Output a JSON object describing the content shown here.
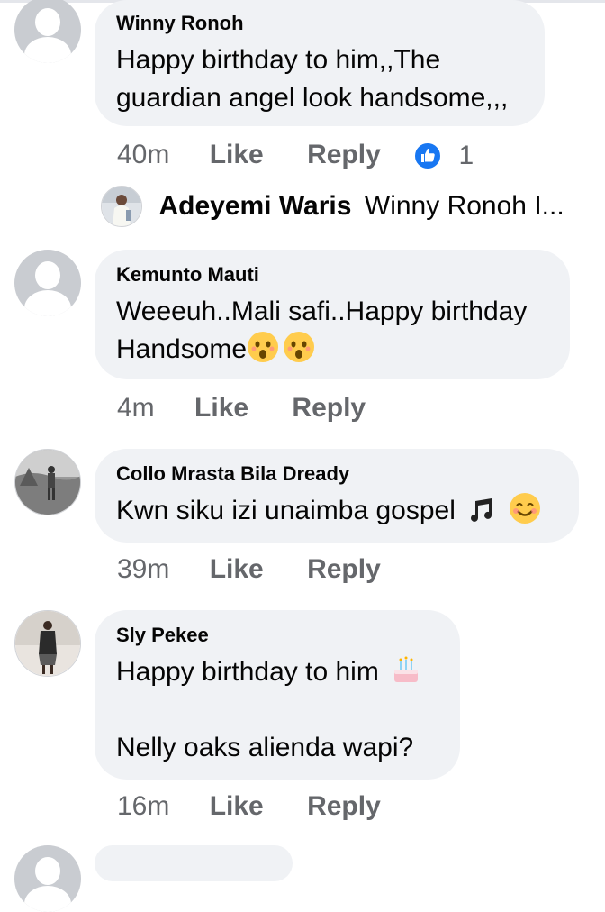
{
  "comments": [
    {
      "author": "Winny Ronoh",
      "lines": [
        "Happy birthday to him,,The",
        "guardian angel look handsome,,,"
      ],
      "time": "40m",
      "like": "Like",
      "reply": "Reply",
      "reaction_count": "1",
      "reaction_icon": "thumbs-up-icon"
    },
    {
      "author": "Kemunto Mauti",
      "lines": [
        "Weeeuh..Mali safi..Happy birthday",
        "Handsome"
      ],
      "time": "4m",
      "like": "Like",
      "reply": "Reply"
    },
    {
      "author": "Collo Mrasta Bila Dready",
      "lines": [
        "Kwn siku izi unaimba gospel"
      ],
      "time": "39m",
      "like": "Like",
      "reply": "Reply"
    },
    {
      "author": "Sly Pekee",
      "lines": [
        "Happy birthday to him",
        "Nelly oaks alienda wapi?"
      ],
      "time": "16m",
      "like": "Like",
      "reply": "Reply"
    }
  ],
  "reply_preview": {
    "author": "Adeyemi Waris",
    "text": "Winny Ronoh I..."
  },
  "colors": {
    "bubble": "#f0f2f5",
    "meta_text": "#65676b",
    "like_blue": "#1877f2"
  }
}
